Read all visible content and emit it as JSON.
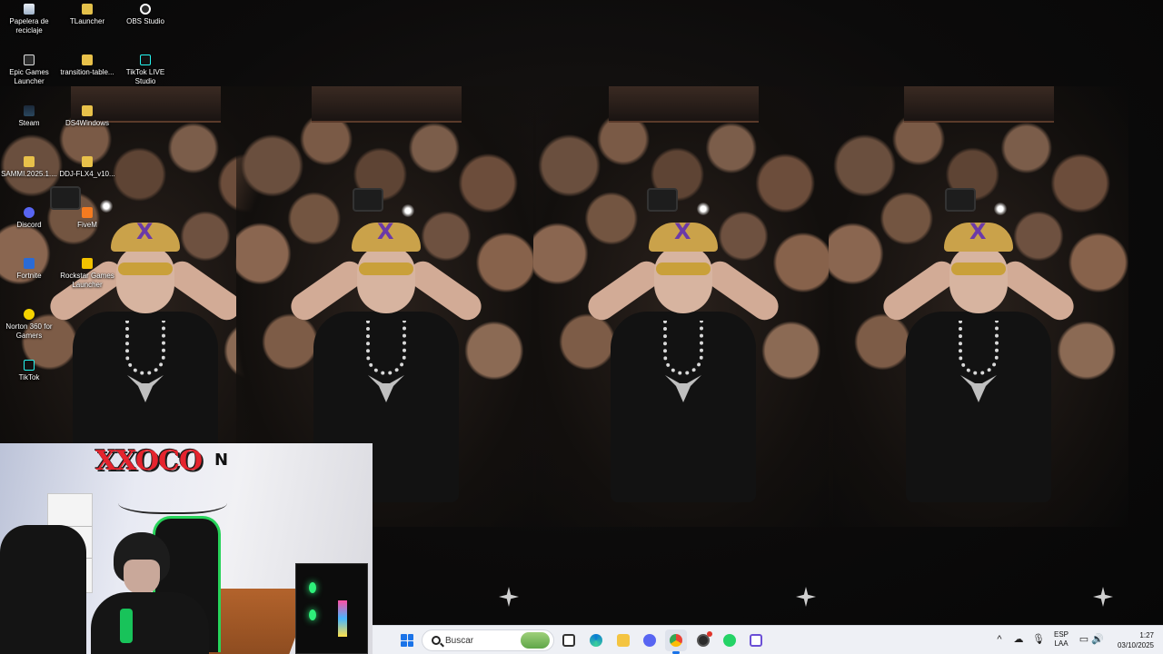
{
  "desktop": {
    "icons": [
      {
        "label": "Papelera de reciclaje",
        "icon": "recycle-bin-icon"
      },
      {
        "label": "TLauncher",
        "icon": "tlauncher-icon"
      },
      {
        "label": "OBS Studio",
        "icon": "obs-icon"
      },
      {
        "label": "Epic Games Launcher",
        "icon": "epic-games-icon"
      },
      {
        "label": "transition-table...",
        "icon": "folder-icon"
      },
      {
        "label": "TikTok LIVE Studio",
        "icon": "tiktok-live-icon"
      },
      {
        "label": "Steam",
        "icon": "steam-icon"
      },
      {
        "label": "DS4Windows",
        "icon": "folder-icon"
      },
      {
        "label": "SAMMI.2025.1....",
        "icon": "folder-icon"
      },
      {
        "label": "DDJ-FLX4_v10...",
        "icon": "folder-icon"
      },
      {
        "label": "Discord",
        "icon": "discord-icon"
      },
      {
        "label": "FiveM",
        "icon": "fivem-icon"
      },
      {
        "label": "Fortnite",
        "icon": "fortnite-icon"
      },
      {
        "label": "Rockstar Games Launcher",
        "icon": "rockstar-icon"
      },
      {
        "label": "Norton 360 for Gamers",
        "icon": "norton-icon"
      },
      {
        "label": "TikTok",
        "icon": "tiktok-icon"
      }
    ]
  },
  "webcam": {
    "wall_text": "XXOCO",
    "wall_text_2": "N"
  },
  "taskbar": {
    "search_placeholder": "Buscar",
    "apps": [
      {
        "name": "start",
        "icon": "windows-start-icon"
      },
      {
        "name": "task-view",
        "icon": "task-view-icon"
      },
      {
        "name": "edge",
        "icon": "edge-icon"
      },
      {
        "name": "file-explorer",
        "icon": "file-explorer-icon"
      },
      {
        "name": "discord",
        "icon": "discord-icon"
      },
      {
        "name": "chrome",
        "icon": "chrome-icon",
        "active": true
      },
      {
        "name": "obs",
        "icon": "obs-icon"
      },
      {
        "name": "whatsapp",
        "icon": "whatsapp-icon"
      },
      {
        "name": "snipping-tool",
        "icon": "snipping-tool-icon"
      }
    ],
    "tray": {
      "chevron": "^",
      "language": "ESP",
      "layout": "LAA",
      "time": "1:27",
      "date": "03/10/2025"
    }
  },
  "colors": {
    "taskbar_bg": "#eef0f5",
    "accent": "#1a73e8",
    "graffiti_red": "#e5232e",
    "rgb_green": "#27d35a"
  }
}
